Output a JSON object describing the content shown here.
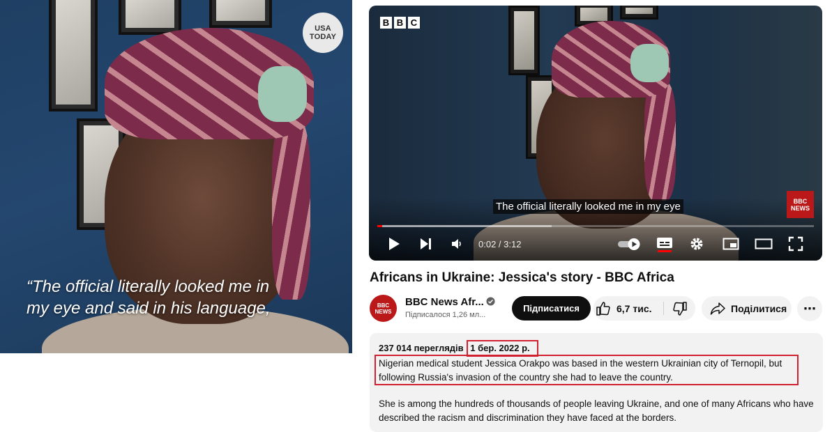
{
  "left_panel": {
    "logo_line1": "USA",
    "logo_line2": "TODAY",
    "caption_line1": "“The official literally looked me in",
    "caption_line2": "my eye and said in his language,"
  },
  "player": {
    "brand_letters": [
      "B",
      "B",
      "C"
    ],
    "news_badge_line1": "BBC",
    "news_badge_line2": "NEWS",
    "subtitle": "The official literally looked me in my eye",
    "time_display": "0:02 / 3:12",
    "progress_played": 0.011,
    "progress_loaded": 0.4,
    "accent_color": "#ff0000",
    "icons": [
      "play-icon",
      "next-icon",
      "volume-icon",
      "autoplay-toggle-icon",
      "subtitles-icon",
      "settings-gear-icon",
      "miniplayer-icon",
      "theater-mode-icon",
      "fullscreen-icon"
    ]
  },
  "video": {
    "title": "Africans in Ukraine: Jessica's story - BBC Africa"
  },
  "channel": {
    "avatar_line1": "BBC",
    "avatar_line2": "NEWS",
    "name": "BBC News Afr...",
    "subscribers": "Підписалося 1,26 мл..."
  },
  "actions": {
    "subscribe_label": "Підписатися",
    "like_count": "6,7 тис.",
    "share_label": "Поділитися",
    "more_label": "⋯"
  },
  "description": {
    "views": "237 014 переглядів",
    "date": "1 бер. 2022 р.",
    "paragraph1": "Nigerian medical student Jessica Orakpo was based in the western Ukrainian city of Ternopil, but following Russia's invasion of the country she had to leave the country.",
    "paragraph2": "She is among the hundreds of thousands of people leaving Ukraine, and one of many Africans who have described the racism and discrimination they have faced at the borders.",
    "highlight_color": "#d32030"
  }
}
